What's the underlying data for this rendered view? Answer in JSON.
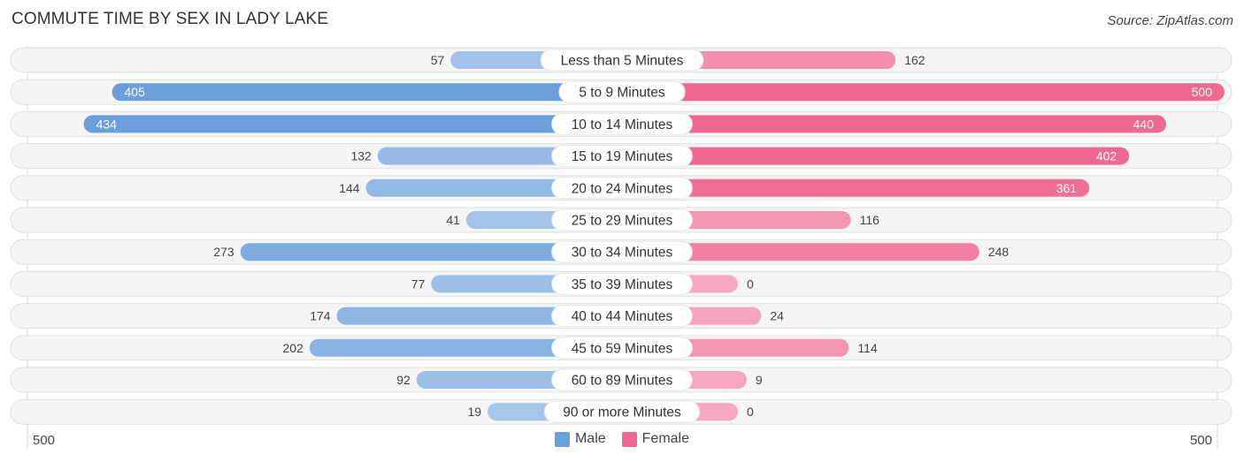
{
  "title": "COMMUTE TIME BY SEX IN LADY LAKE",
  "source": "Source: ZipAtlas.com",
  "colors": {
    "male": "#6a9fdb",
    "female": "#f06890",
    "male_light": "#a9c8ea",
    "female_light": "#f6a8c0"
  },
  "chart_data": {
    "type": "bar",
    "orientation": "horizontal-diverging",
    "title": "COMMUTE TIME BY SEX IN LADY LAKE",
    "categories": [
      "Less than 5 Minutes",
      "5 to 9 Minutes",
      "10 to 14 Minutes",
      "15 to 19 Minutes",
      "20 to 24 Minutes",
      "25 to 29 Minutes",
      "30 to 34 Minutes",
      "35 to 39 Minutes",
      "40 to 44 Minutes",
      "45 to 59 Minutes",
      "60 to 89 Minutes",
      "90 or more Minutes"
    ],
    "series": [
      {
        "name": "Male",
        "values": [
          57,
          405,
          434,
          132,
          144,
          41,
          273,
          77,
          174,
          202,
          92,
          19
        ]
      },
      {
        "name": "Female",
        "values": [
          162,
          500,
          440,
          402,
          361,
          116,
          248,
          0,
          24,
          114,
          9,
          0
        ]
      }
    ],
    "axis_left_label": "500",
    "axis_right_label": "500",
    "xlim": [
      0,
      500
    ],
    "legend": [
      "Male",
      "Female"
    ],
    "legend_position": "bottom-center"
  }
}
